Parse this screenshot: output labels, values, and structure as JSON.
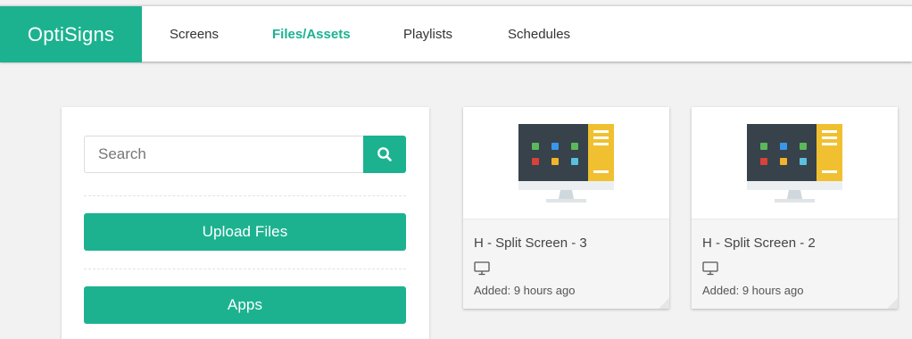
{
  "brand": {
    "name": "OptiSigns",
    "color": "#1cb290"
  },
  "nav": {
    "items": [
      {
        "label": "Screens",
        "active": false
      },
      {
        "label": "Files/Assets",
        "active": true
      },
      {
        "label": "Playlists",
        "active": false
      },
      {
        "label": "Schedules",
        "active": false
      }
    ]
  },
  "sidebar": {
    "search": {
      "placeholder": "Search",
      "value": "",
      "icon": "search-icon"
    },
    "buttons": [
      {
        "label": "Upload Files"
      },
      {
        "label": "Apps"
      }
    ]
  },
  "assets": [
    {
      "title": "H - Split Screen - 3",
      "type_icon": "monitor-icon",
      "added": "Added: 9 hours ago",
      "thumbnail_icon": "split-screen-monitor-icon"
    },
    {
      "title": "H - Split Screen - 2",
      "type_icon": "monitor-icon",
      "added": "Added: 9 hours ago",
      "thumbnail_icon": "split-screen-monitor-icon"
    }
  ],
  "colors": {
    "accent": "#1cb290",
    "monitor_screen": "#37424a",
    "monitor_panel": "#f0c030",
    "dot_green": "#5cb85c",
    "dot_blue": "#3a97e8",
    "dot_red": "#d9413a",
    "dot_yellow": "#f0b52a",
    "dot_cyan": "#5bc0de"
  }
}
